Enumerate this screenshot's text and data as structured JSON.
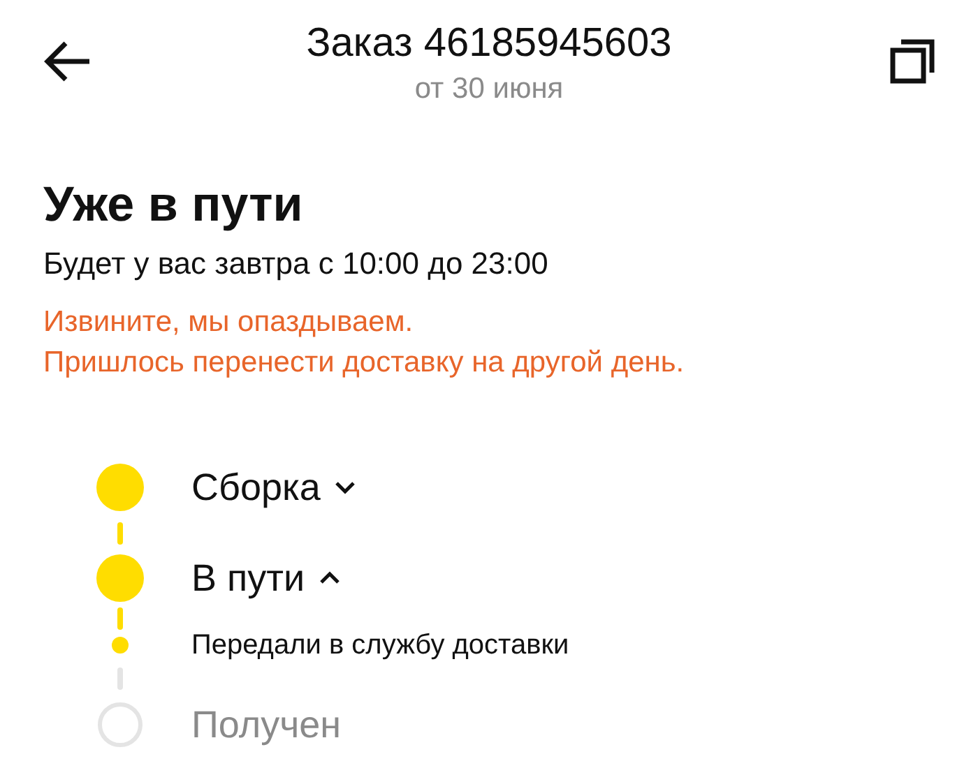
{
  "header": {
    "title": "Заказ 46185945603",
    "subtitle": "от 30 июня"
  },
  "status": {
    "title": "Уже в пути",
    "eta": "Будет у вас завтра с 10:00 до 23:00"
  },
  "notice": [
    "Извините, мы опаздываем.",
    "Пришлось перенести доставку на другой день."
  ],
  "steps": [
    {
      "kind": "stage",
      "label": "Сборка",
      "completed": true,
      "expanded": false
    },
    {
      "kind": "stage",
      "label": "В пути",
      "completed": true,
      "expanded": true
    },
    {
      "kind": "event",
      "label": "Передали в службу доставки",
      "completed": true
    },
    {
      "kind": "stage",
      "label": "Получен",
      "completed": false
    }
  ]
}
